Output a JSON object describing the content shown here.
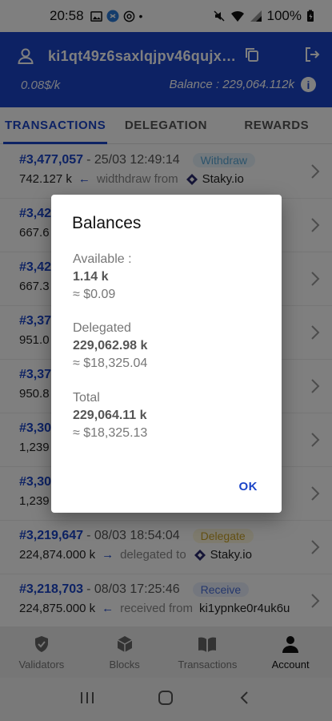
{
  "status_bar": {
    "time": "20:58",
    "battery": "100%"
  },
  "header": {
    "address": "ki1qt49z6saxlqjpv46qujx…",
    "price": "0.08$/k",
    "balance": "Balance : 229,064.112k"
  },
  "tabs": [
    {
      "label": "TRANSACTIONS",
      "active": true
    },
    {
      "label": "DELEGATION",
      "active": false
    },
    {
      "label": "REWARDS",
      "active": false
    }
  ],
  "transactions": [
    {
      "id": "#3,477,057",
      "date": "- 25/03 12:49:14",
      "badge": "Withdraw",
      "amount": "742.127 k",
      "arrow": "←",
      "action": "widthdraw from",
      "counterparty": "Staky.io"
    },
    {
      "id": "#3,42",
      "date": "",
      "badge": "",
      "amount": "667.6",
      "arrow": "",
      "action": "",
      "counterparty": ""
    },
    {
      "id": "#3,42",
      "date": "",
      "badge": "",
      "amount": "667.3",
      "arrow": "",
      "action": "",
      "counterparty": ""
    },
    {
      "id": "#3,37",
      "date": "",
      "badge": "",
      "amount": "951.0",
      "arrow": "",
      "action": "",
      "counterparty": ""
    },
    {
      "id": "#3,37",
      "date": "",
      "badge": "",
      "amount": "950.8",
      "arrow": "",
      "action": "",
      "counterparty": ""
    },
    {
      "id": "#3,30",
      "date": "",
      "badge": "",
      "amount": "1,239",
      "arrow": "",
      "action": "",
      "counterparty": ""
    },
    {
      "id": "#3,30",
      "date": "",
      "badge": "",
      "amount": "1,239",
      "arrow": "",
      "action": "",
      "counterparty": ""
    },
    {
      "id": "#3,219,647",
      "date": "- 08/03 18:54:04",
      "badge": "Delegate",
      "amount": "224,874.000 k",
      "arrow": "→",
      "action": "delegated to",
      "counterparty": "Staky.io"
    },
    {
      "id": "#3,218,703",
      "date": "- 08/03 17:25:46",
      "badge": "Receive",
      "amount": "224,875.000 k",
      "arrow": "←",
      "action": "received from",
      "counterparty": "ki1ypnke0r4uk6u"
    }
  ],
  "badge_colors": {
    "Withdraw": {
      "bg": "#e6f3fb",
      "fg": "#5aa7d6"
    },
    "Delegate": {
      "bg": "#fdf6dc",
      "fg": "#c9a227"
    },
    "Receive": {
      "bg": "#e8eefc",
      "fg": "#4a6fd8"
    }
  },
  "bottom_nav": [
    {
      "label": "Validators",
      "icon": "shield-check-icon",
      "active": false
    },
    {
      "label": "Blocks",
      "icon": "cube-icon",
      "active": false
    },
    {
      "label": "Transactions",
      "icon": "book-icon",
      "active": false
    },
    {
      "label": "Account",
      "icon": "person-icon",
      "active": true
    }
  ],
  "dialog": {
    "title": "Balances",
    "available_label": "Available :",
    "available_amount": "1.14 k",
    "available_usd": "≈ $0.09",
    "delegated_label": "Delegated",
    "delegated_amount": "229,062.98 k",
    "delegated_usd": "≈ $18,325.04",
    "total_label": "Total",
    "total_amount": "229,064.11 k",
    "total_usd": "≈ $18,325.13",
    "ok_label": "OK"
  },
  "colors": {
    "primary": "#1b45c8"
  }
}
